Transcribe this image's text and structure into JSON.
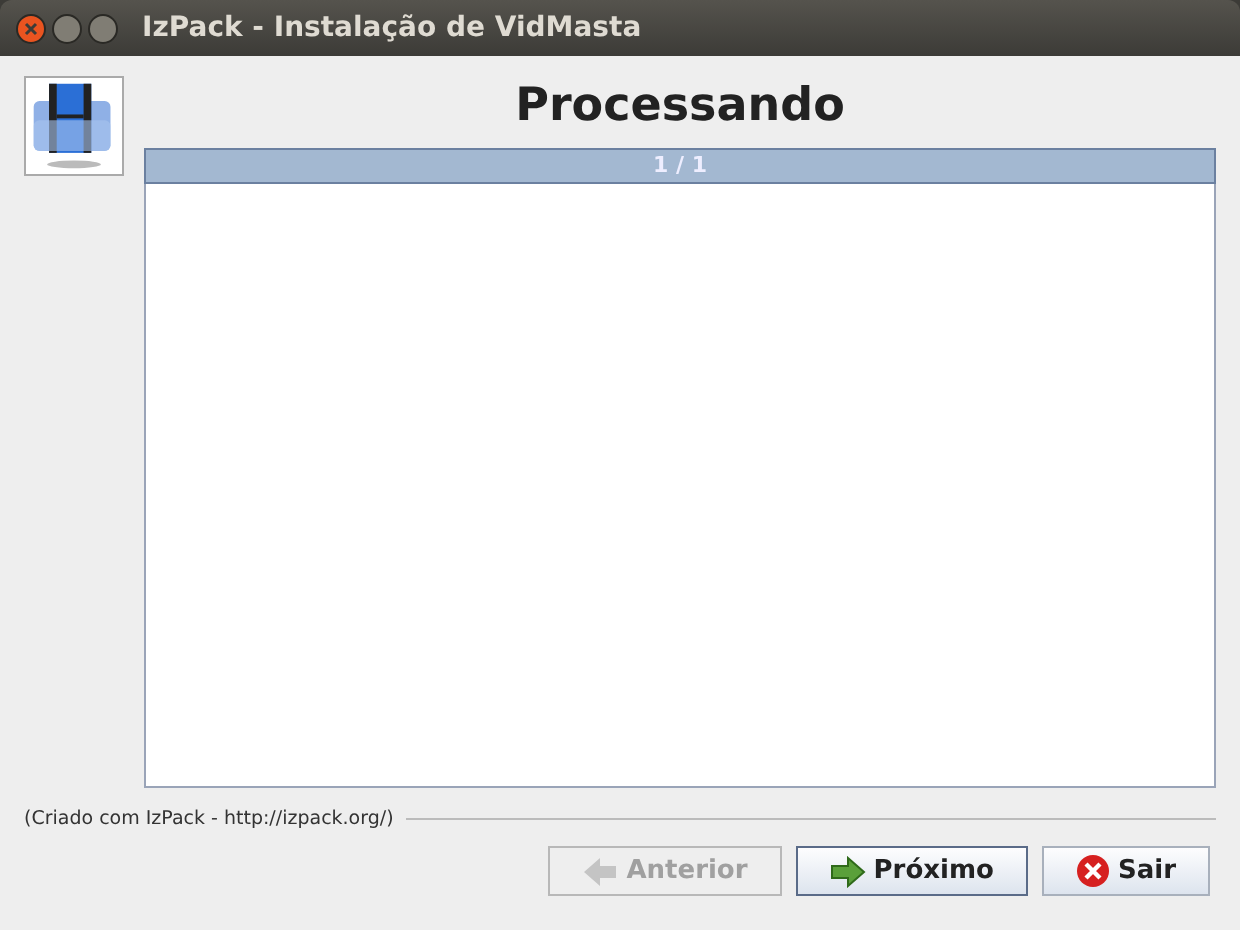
{
  "window": {
    "title": "IzPack - Instalação de VidMasta"
  },
  "heading": "Processando",
  "progress": {
    "label": "1 / 1",
    "level": 1
  },
  "credit": "(Criado com IzPack - http://izpack.org/)",
  "buttons": [
    {
      "label": "Anterior",
      "kind": "back",
      "disabled": true,
      "selected": false
    },
    {
      "label": "Próximo",
      "kind": "next",
      "disabled": false,
      "selected": true
    },
    {
      "label": "Sair",
      "kind": "quit",
      "disabled": false,
      "selected": false
    }
  ]
}
